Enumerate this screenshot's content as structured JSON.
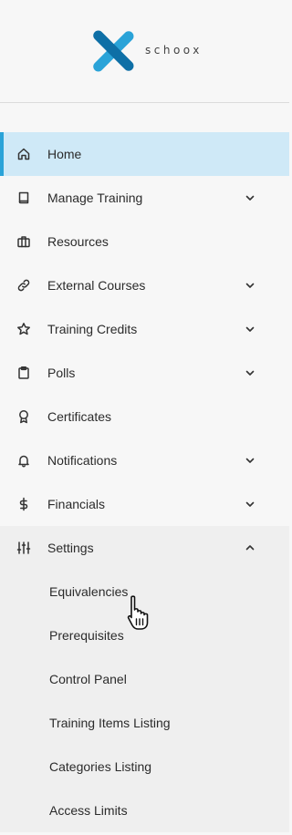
{
  "brand": {
    "name": "schoox",
    "colors": {
      "primary": "#2aa3d8",
      "dark": "#0e6fa6"
    }
  },
  "menu": {
    "active_color": "#cfe9f7",
    "items": [
      {
        "label": "Home",
        "icon": "home-icon",
        "has_children": false,
        "active": true
      },
      {
        "label": "Manage Training",
        "icon": "book-icon",
        "has_children": true
      },
      {
        "label": "Resources",
        "icon": "briefcase-icon",
        "has_children": false
      },
      {
        "label": "External Courses",
        "icon": "link-icon",
        "has_children": true
      },
      {
        "label": "Training Credits",
        "icon": "star-icon",
        "has_children": true
      },
      {
        "label": "Polls",
        "icon": "clipboard-icon",
        "has_children": true
      },
      {
        "label": "Certificates",
        "icon": "award-icon",
        "has_children": false
      },
      {
        "label": "Notifications",
        "icon": "bell-icon",
        "has_children": true
      },
      {
        "label": "Financials",
        "icon": "dollar-icon",
        "has_children": true
      },
      {
        "label": "Settings",
        "icon": "sliders-icon",
        "has_children": true,
        "expanded": true
      }
    ],
    "settings_submenu": [
      {
        "label": "Equivalencies"
      },
      {
        "label": "Prerequisites"
      },
      {
        "label": "Control Panel"
      },
      {
        "label": "Training Items Listing"
      },
      {
        "label": "Categories Listing"
      },
      {
        "label": "Access Limits"
      }
    ]
  }
}
